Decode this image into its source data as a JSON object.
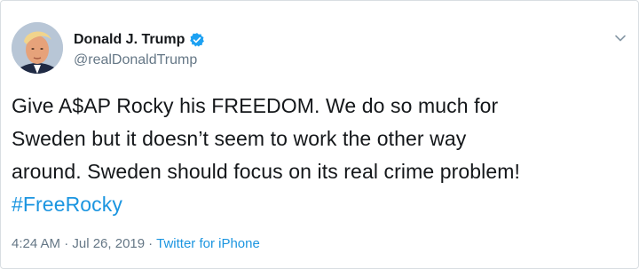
{
  "author": {
    "display_name": "Donald J. Trump",
    "handle": "@realDonaldTrump",
    "verified": true,
    "avatar_icon": "profile-photo"
  },
  "menu_icon": "chevron-down-icon",
  "tweet": {
    "lines": [
      "Give A$AP Rocky his FREEDOM. We do so much for",
      "Sweden but it doesn’t seem to work the other way",
      "around. Sweden should focus on its real crime problem!"
    ],
    "hashtag": "#FreeRocky"
  },
  "meta": {
    "timestamp": "4:24 AM · Jul 26, 2019",
    "separator": "·",
    "source": "Twitter for iPhone"
  },
  "colors": {
    "link": "#1b95e0",
    "secondary_text": "#657786",
    "verified": "#1da1f2"
  }
}
